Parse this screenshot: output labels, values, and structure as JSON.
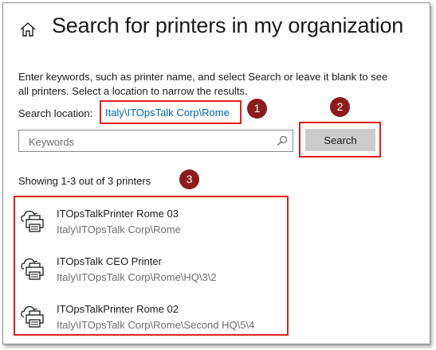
{
  "header": {
    "title": "Search for printers in my organization",
    "home_icon": "home-icon"
  },
  "instructions": "Enter keywords, such as printer name, and select Search or leave it blank to see all printers. Select a location to narrow the results.",
  "location": {
    "label": "Search location:",
    "value": "Italy\\ITOpsTalk Corp\\Rome"
  },
  "search": {
    "placeholder": "Keywords",
    "value": "",
    "button_label": "Search",
    "icon": "magnifier-icon"
  },
  "results": {
    "summary": "Showing 1-3 out of 3 printers",
    "items": [
      {
        "name": "ITOpsTalkPrinter Rome 03",
        "path": "Italy\\ITOpsTalk Corp\\Rome"
      },
      {
        "name": "ITOpsTalk CEO Printer",
        "path": "Italy\\ITOpsTalk Corp\\Rome\\HQ\\3\\2"
      },
      {
        "name": "ITOpsTalkPrinter Rome 02",
        "path": "Italy\\ITOpsTalk Corp\\Rome\\Second HQ\\5\\4"
      }
    ]
  },
  "callouts": [
    "1",
    "2",
    "3"
  ],
  "colors": {
    "highlight_border": "#e02020",
    "badge": "#8c1c1c",
    "link": "#0066b4",
    "secondary_text": "#6d6d6d",
    "button_bg": "#cccccc"
  }
}
